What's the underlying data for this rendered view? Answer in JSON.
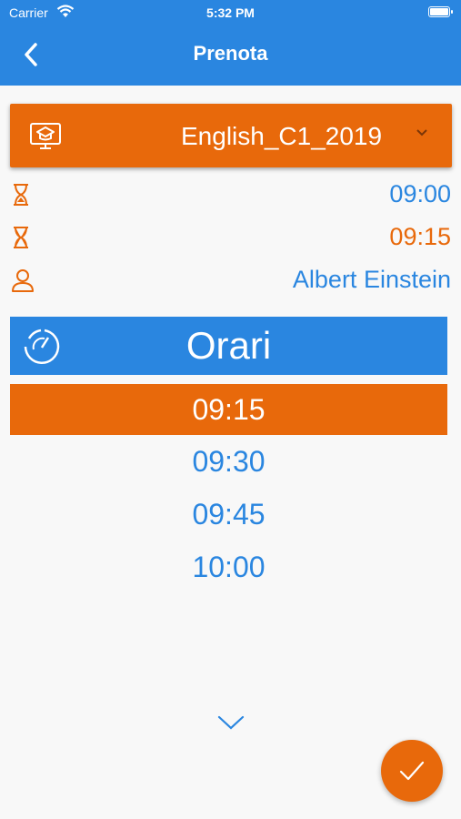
{
  "status_bar": {
    "carrier": "Carrier",
    "time": "5:32 PM",
    "battery_level": 1.0
  },
  "header": {
    "title": "Prenota",
    "back_icon": "chevron-left-icon"
  },
  "course_selector": {
    "value": "English_C1_2019",
    "icon": "computer-graduation-icon",
    "dropdown_icon": "chevron-down-icon"
  },
  "details": {
    "start_time": "09:00",
    "end_time": "09:15",
    "teacher": "Albert Einstein"
  },
  "schedule": {
    "label": "Orari",
    "slots": [
      "09:15",
      "09:30",
      "09:45",
      "10:00"
    ],
    "selected_index": 0
  },
  "colors": {
    "primary_blue": "#2a86e0",
    "accent_orange": "#e8690b",
    "background": "#f8f8f8"
  },
  "actions": {
    "confirm_icon": "checkmark-icon",
    "scroll_icon": "chevron-down-icon"
  }
}
